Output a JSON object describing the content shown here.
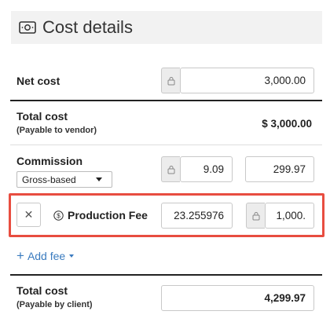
{
  "header": {
    "title": "Cost details",
    "icon": "money-icon"
  },
  "net_cost": {
    "label": "Net cost",
    "value": "3,000.00"
  },
  "total_vendor": {
    "label": "Total cost",
    "sublabel": "(Payable to vendor)",
    "value": "$ 3,000.00"
  },
  "commission": {
    "label": "Commission",
    "basis_selected": "Gross-based",
    "percent": "9.09",
    "amount": "299.97"
  },
  "production_fee": {
    "label": "Production Fee",
    "percent": "23.255976",
    "amount": "1,000."
  },
  "add_fee": {
    "label": "Add fee"
  },
  "total_client": {
    "label": "Total cost",
    "sublabel": "(Payable by client)",
    "value": "4,299.97"
  },
  "colors": {
    "highlight": "#e84d40",
    "link": "#3a7bbf"
  }
}
